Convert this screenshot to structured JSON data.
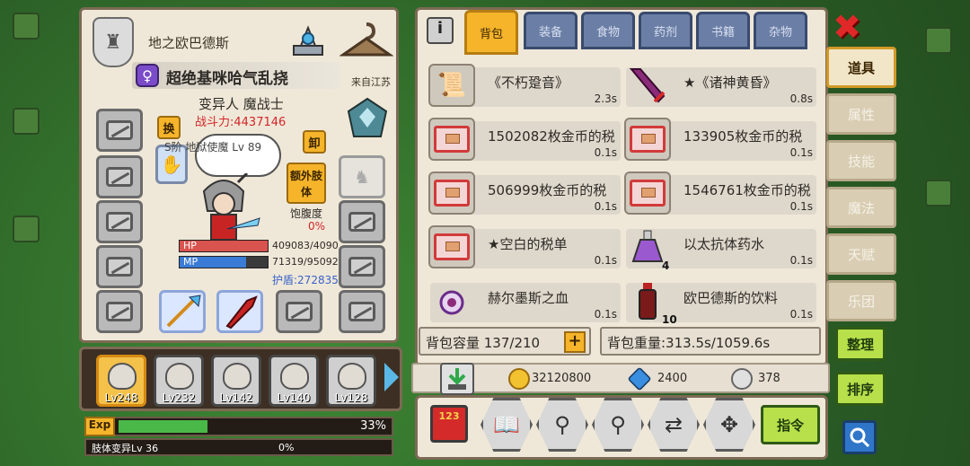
{
  "player": {
    "name": "地之欧巴德斯",
    "title": "超绝基咪哈气乱挠",
    "origin": "来自江苏",
    "class": "变异人 魔战士",
    "power_label": "战斗力:4437146",
    "skill_label": "S阶 地狱使魔 Lv 89",
    "swap_label": "换",
    "unequip_label": "卸",
    "extra_limb_label": "额外肢体",
    "hunger_label": "饱腹度",
    "hunger_value": "0%",
    "hp_label": "HP",
    "hp_value": "409083/4090",
    "hp_fraction": 1.0,
    "mp_label": "MP",
    "mp_value": "71319/95092",
    "mp_fraction": 0.75,
    "shield_label": "护盾:272835"
  },
  "party": [
    {
      "lv": "Lv248",
      "active": true
    },
    {
      "lv": "Lv232",
      "active": false
    },
    {
      "lv": "Lv142",
      "active": false
    },
    {
      "lv": "Lv140",
      "active": false
    },
    {
      "lv": "Lv128",
      "active": false
    }
  ],
  "exp": {
    "label": "Exp",
    "percent": "33%",
    "fraction": 0.33,
    "limb_label": "肢体变异Lv 36",
    "limb_percent": "0%"
  },
  "inventory": {
    "info_label": "i",
    "tabs": [
      "背包",
      "装备",
      "食物",
      "药剂",
      "书籍",
      "杂物"
    ],
    "active_tab": 0,
    "items": [
      {
        "name": "《不朽跫音》",
        "weight": "2.3s",
        "icon": "scroll-icon",
        "count": ""
      },
      {
        "name": "★《诸神黄昏》",
        "weight": "0.8s",
        "icon": "sword-icon",
        "count": ""
      },
      {
        "name": "1502082枚金币的税",
        "weight": "0.1s",
        "icon": "tax-bill-icon",
        "count": ""
      },
      {
        "name": "133905枚金币的税",
        "weight": "0.1s",
        "icon": "tax-bill-icon",
        "count": ""
      },
      {
        "name": "506999枚金币的税",
        "weight": "0.1s",
        "icon": "tax-bill-icon",
        "count": ""
      },
      {
        "name": "1546761枚金币的税",
        "weight": "0.1s",
        "icon": "tax-bill-icon",
        "count": ""
      },
      {
        "name": "★空白的税单",
        "weight": "0.1s",
        "icon": "tax-bill-icon",
        "count": ""
      },
      {
        "name": "以太抗体药水",
        "weight": "0.1s",
        "icon": "potion-icon",
        "count": "4"
      },
      {
        "name": "赫尔墨斯之血",
        "weight": "0.1s",
        "icon": "blood-orb-icon",
        "count": ""
      },
      {
        "name": "欧巴德斯的饮料",
        "weight": "0.1s",
        "icon": "drink-bottle-icon",
        "count": "10"
      }
    ],
    "capacity_label": "背包容量 137/210",
    "capacity_plus": "+",
    "weight_label": "背包重量:313.5s/1059.6s"
  },
  "currency": {
    "gold": "32120800",
    "diamond": "2400",
    "silver": "378"
  },
  "tools": {
    "sort_label": "123",
    "command_label": "指令"
  },
  "side_menu": {
    "close_label": "✖",
    "tabs": [
      "道具",
      "属性",
      "技能",
      "魔法",
      "天赋",
      "乐团"
    ],
    "active_tab": 0,
    "arrange_label": "整理",
    "sort_label": "排序"
  },
  "colors": {
    "accent": "#f5b42a",
    "tab_blue": "#6b7fa6",
    "hp_red": "#d9534f",
    "mp_blue": "#3a7bd5",
    "exp_green": "#49b848",
    "danger": "#d3262a"
  }
}
